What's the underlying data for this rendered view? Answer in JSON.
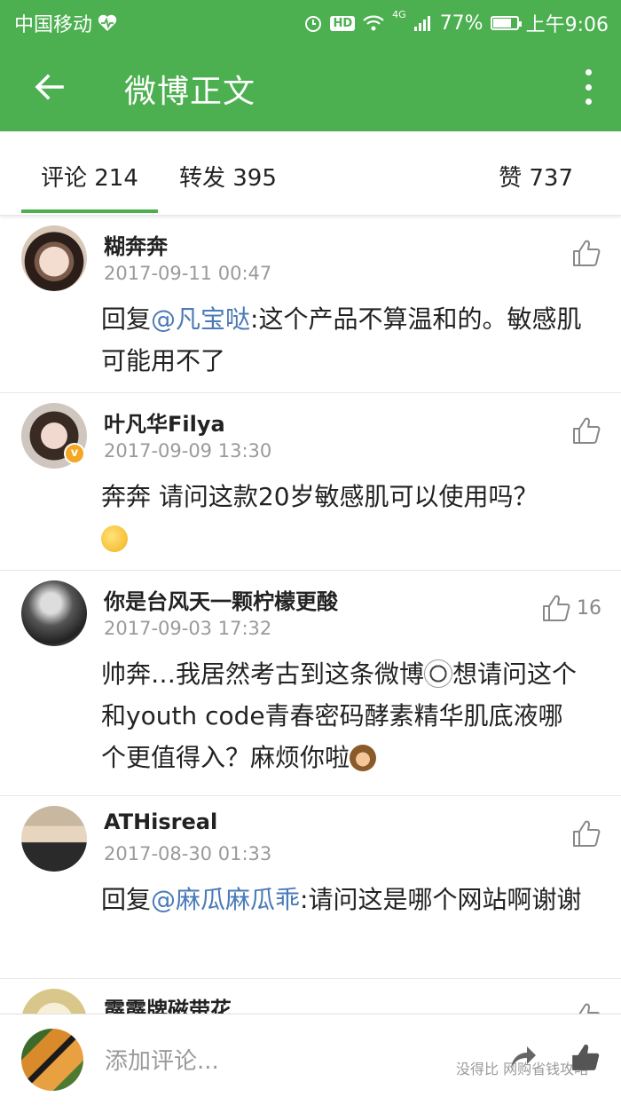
{
  "status_bar": {
    "carrier": "中国移动",
    "hd": "HD",
    "network": "4G",
    "battery": "77%",
    "battery_level": 0.77,
    "time": "上午9:06"
  },
  "header": {
    "title": "微博正文"
  },
  "tabs": [
    {
      "label": "评论 214"
    },
    {
      "label": "转发 395"
    },
    {
      "label": "赞 737"
    }
  ],
  "comments": [
    {
      "user": "糊奔奔",
      "time": "2017-09-11 00:47",
      "prefix": "回复",
      "mention": "@凡宝哒",
      "text": ":这个产品不算温和的。敏感肌可能用不了",
      "likes": ""
    },
    {
      "user": "叶凡华Filya",
      "time": "2017-09-09 13:30",
      "prefix": "",
      "mention": "",
      "text": "奔奔 请问这款20岁敏感肌可以使用吗？",
      "likes": ""
    },
    {
      "user": "你是台风天一颗柠檬更酸",
      "time": "2017-09-03 17:32",
      "prefix": "",
      "mention": "",
      "text": "帅奔…我居然考古到这条微博",
      "text2": "想请问这个和youth code青春密码酵素精华肌底液哪个更值得入？麻烦你啦",
      "likes": "16"
    },
    {
      "user": "ATHisreal",
      "time": "2017-08-30 01:33",
      "prefix": "回复",
      "mention": "@麻瓜麻瓜乖",
      "text": ":请问这是哪个网站啊谢谢",
      "likes": ""
    },
    {
      "user": "霹霹牌磁带花",
      "time": "",
      "prefix": "",
      "mention": "",
      "text": "",
      "likes": ""
    }
  ],
  "bottom_bar": {
    "placeholder": "添加评论...",
    "watermark": "没得比 网购省钱攻略"
  },
  "colors": {
    "accent": "#4caf50",
    "mention": "#4a7ab8",
    "time": "#9a9a9a"
  }
}
